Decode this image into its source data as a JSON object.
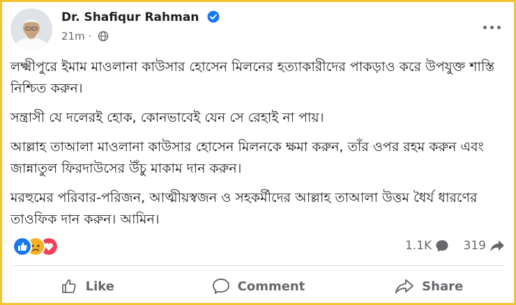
{
  "post": {
    "author": "Dr. Shafiqur Rahman",
    "time": "21m",
    "separator": "·",
    "paragraphs": [
      "লক্ষ্মীপুরে ইমাম মাওলানা কাউসার হোসেন মিলনের হত্যাকারীদের পাকড়াও করে উপযুক্ত শাস্তি নিশ্চিত করুন।",
      "সন্ত্রাসী যে দলেরই হোক, কোনভাবেই যেন সে রেহাই না পায়।",
      "আল্লাহ তাআলা মাওলানা কাউসার হোসেন মিলনকে ক্ষমা করুন, তাঁর ওপর রহম করুন এবং জান্নাতুল ফিরদাউসের উঁচু মাকাম দান করুন।",
      "মরহুমের পরিবার-পরিজন, আত্মীয়স্বজন ও সহকর্মীদের আল্লাহ তাআলা উত্তম ধৈর্য ধারণের তাওফিক দান করুন। আমিন।"
    ]
  },
  "stats": {
    "comments": "1.1K",
    "shares": "319",
    "reaction_icons": [
      "like-icon",
      "sad-icon",
      "love-icon"
    ]
  },
  "actions": {
    "like": "Like",
    "comment": "Comment",
    "share": "Share"
  },
  "colors": {
    "frame": "#f4c430",
    "verified": "#1877f2",
    "muted": "#65676b",
    "like": "#1877f2",
    "love": "#f33e58",
    "sad": "#f7b125"
  }
}
